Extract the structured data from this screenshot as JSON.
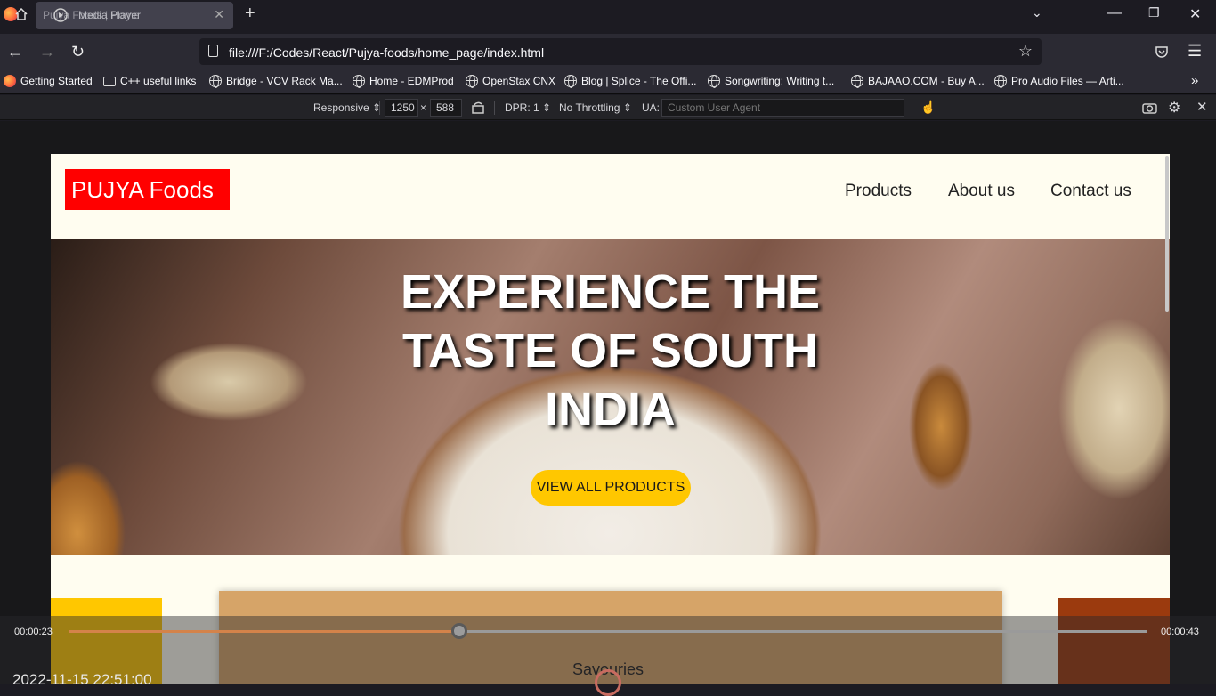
{
  "browser": {
    "tab_title": "Pujya Foods | Home",
    "tab_overlay_title": "Media Player",
    "url": "file:///F:/Codes/React/Pujya-foods/home_page/index.html"
  },
  "bookmarks": [
    {
      "label": "Getting Started",
      "icon": "firefox-icon"
    },
    {
      "label": "C++ useful links",
      "icon": "folder-icon"
    },
    {
      "label": "Bridge - VCV Rack Ma...",
      "icon": "globe-icon"
    },
    {
      "label": "Home - EDMProd",
      "icon": "globe-icon"
    },
    {
      "label": "OpenStax CNX",
      "icon": "globe-icon"
    },
    {
      "label": "Blog | Splice - The Offi...",
      "icon": "globe-icon"
    },
    {
      "label": "Songwriting: Writing t...",
      "icon": "globe-icon"
    },
    {
      "label": "BAJAAO.COM - Buy A...",
      "icon": "globe-icon"
    },
    {
      "label": "Pro Audio Files — Arti...",
      "icon": "globe-icon"
    }
  ],
  "rdm": {
    "device": "Responsive",
    "width": "1250",
    "height": "588",
    "times": "×",
    "dpr": "DPR: 1",
    "throttling": "No Throttling",
    "ua_label": "UA:",
    "ua_placeholder": "Custom User Agent"
  },
  "site": {
    "logo": "PUJYA Foods",
    "nav": [
      "Products",
      "About us",
      "Contact us"
    ],
    "hero_title": "EXPERIENCE THE TASTE OF SOUTH INDIA",
    "cta": "VIEW ALL PRODUCTS",
    "card_title": "Savouries"
  },
  "player": {
    "current_time": "00:00:23",
    "duration": "00:00:43",
    "progress": 0.3621,
    "timestamp": "2022-11-15 22:51:00"
  },
  "colors": {
    "logo_bg": "#ff0000",
    "cta_bg": "#ffc700",
    "page_bg": "#fffdf0",
    "progress": "#d4834a"
  }
}
